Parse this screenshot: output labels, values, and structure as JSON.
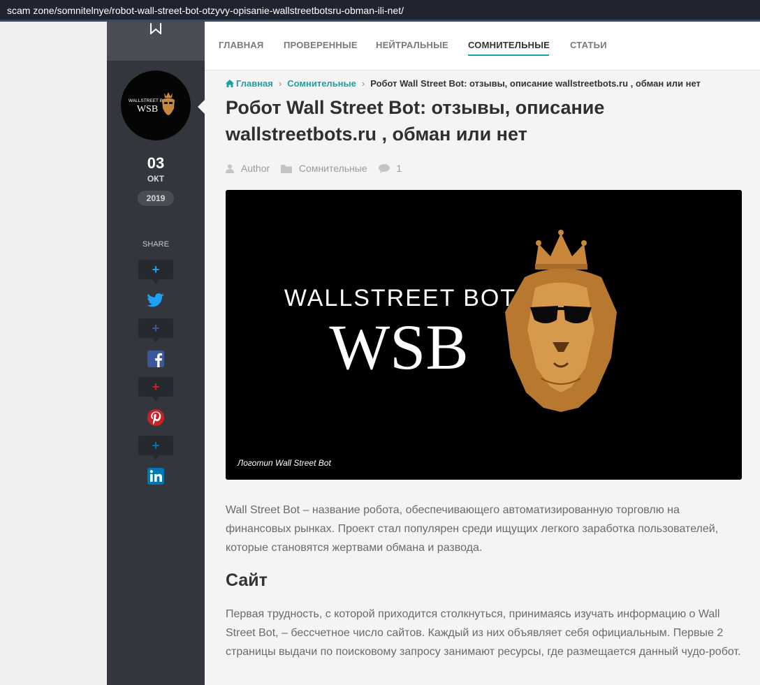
{
  "browser": {
    "url": "scam zone/somnitelnye/robot-wall-street-bot-otzyvy-opisanie-wallstreetbotsru-obman-ili-net/"
  },
  "nav": {
    "items": [
      "ГЛАВНАЯ",
      "ПРОВЕРЕННЫЕ",
      "НЕЙТРАЛЬНЫЕ",
      "СОМНИТЕЛЬНЫЕ",
      "СТАТЬИ"
    ],
    "active": "СОМНИТЕЛЬНЫЕ"
  },
  "sidebar": {
    "avatar_logo": {
      "line1": "WALLSTREET BOT",
      "line2": "WSB"
    },
    "date": {
      "day": "03",
      "month": "ОКТ",
      "year": "2019"
    },
    "share_label": "SHARE",
    "share_plus": "+",
    "share_buttons": [
      {
        "icon": "twitter-icon",
        "color": "#1da1f2",
        "plus_color": "#1da1f2"
      },
      {
        "icon": "facebook-icon",
        "color": "#3b5998",
        "plus_color": "#3b5998"
      },
      {
        "icon": "pinterest-icon",
        "color": "#cb2027",
        "plus_color": "#cb2027"
      },
      {
        "icon": "linkedin-icon",
        "color": "#0077b5",
        "plus_color": "#0077b5"
      }
    ]
  },
  "breadcrumb": {
    "home": "Главная",
    "category": "Сомнительные",
    "current": "Робот Wall Street Bot: отзывы, описание wallstreetbots.ru , обман или нет"
  },
  "article": {
    "title": "Робот Wall Street Bot: отзывы, описание wallstreetbots.ru , обман или нет",
    "meta": {
      "author": "Author",
      "category": "Сомнительные",
      "comments": "1"
    },
    "hero": {
      "logo_line1": "WALLSTREET BOT",
      "logo_line2": "WSB",
      "caption": "Логотип Wall Street Bot"
    },
    "intro": "Wall Street Bot – название робота, обеспечивающего автоматизированную торговлю на финансовых рынках. Проект стал популярен среди ищущих легкого заработка пользователей, которые становятся жертвами обмана и развода.",
    "section_title": "Сайт",
    "section_text": "Первая трудность, с которой приходится столкнуться, принимаясь изучать информацию о Wall Street Bot, – бессчетное число сайтов. Каждый из них объявляет себя официальным. Первые 2 страницы выдачи по поисковому запросу занимают ресурсы, где размещается данный чудо-робот."
  },
  "colors": {
    "accent": "#1e9fa0",
    "sidebar_bg": "#33373d",
    "gold": "#c8873a"
  }
}
